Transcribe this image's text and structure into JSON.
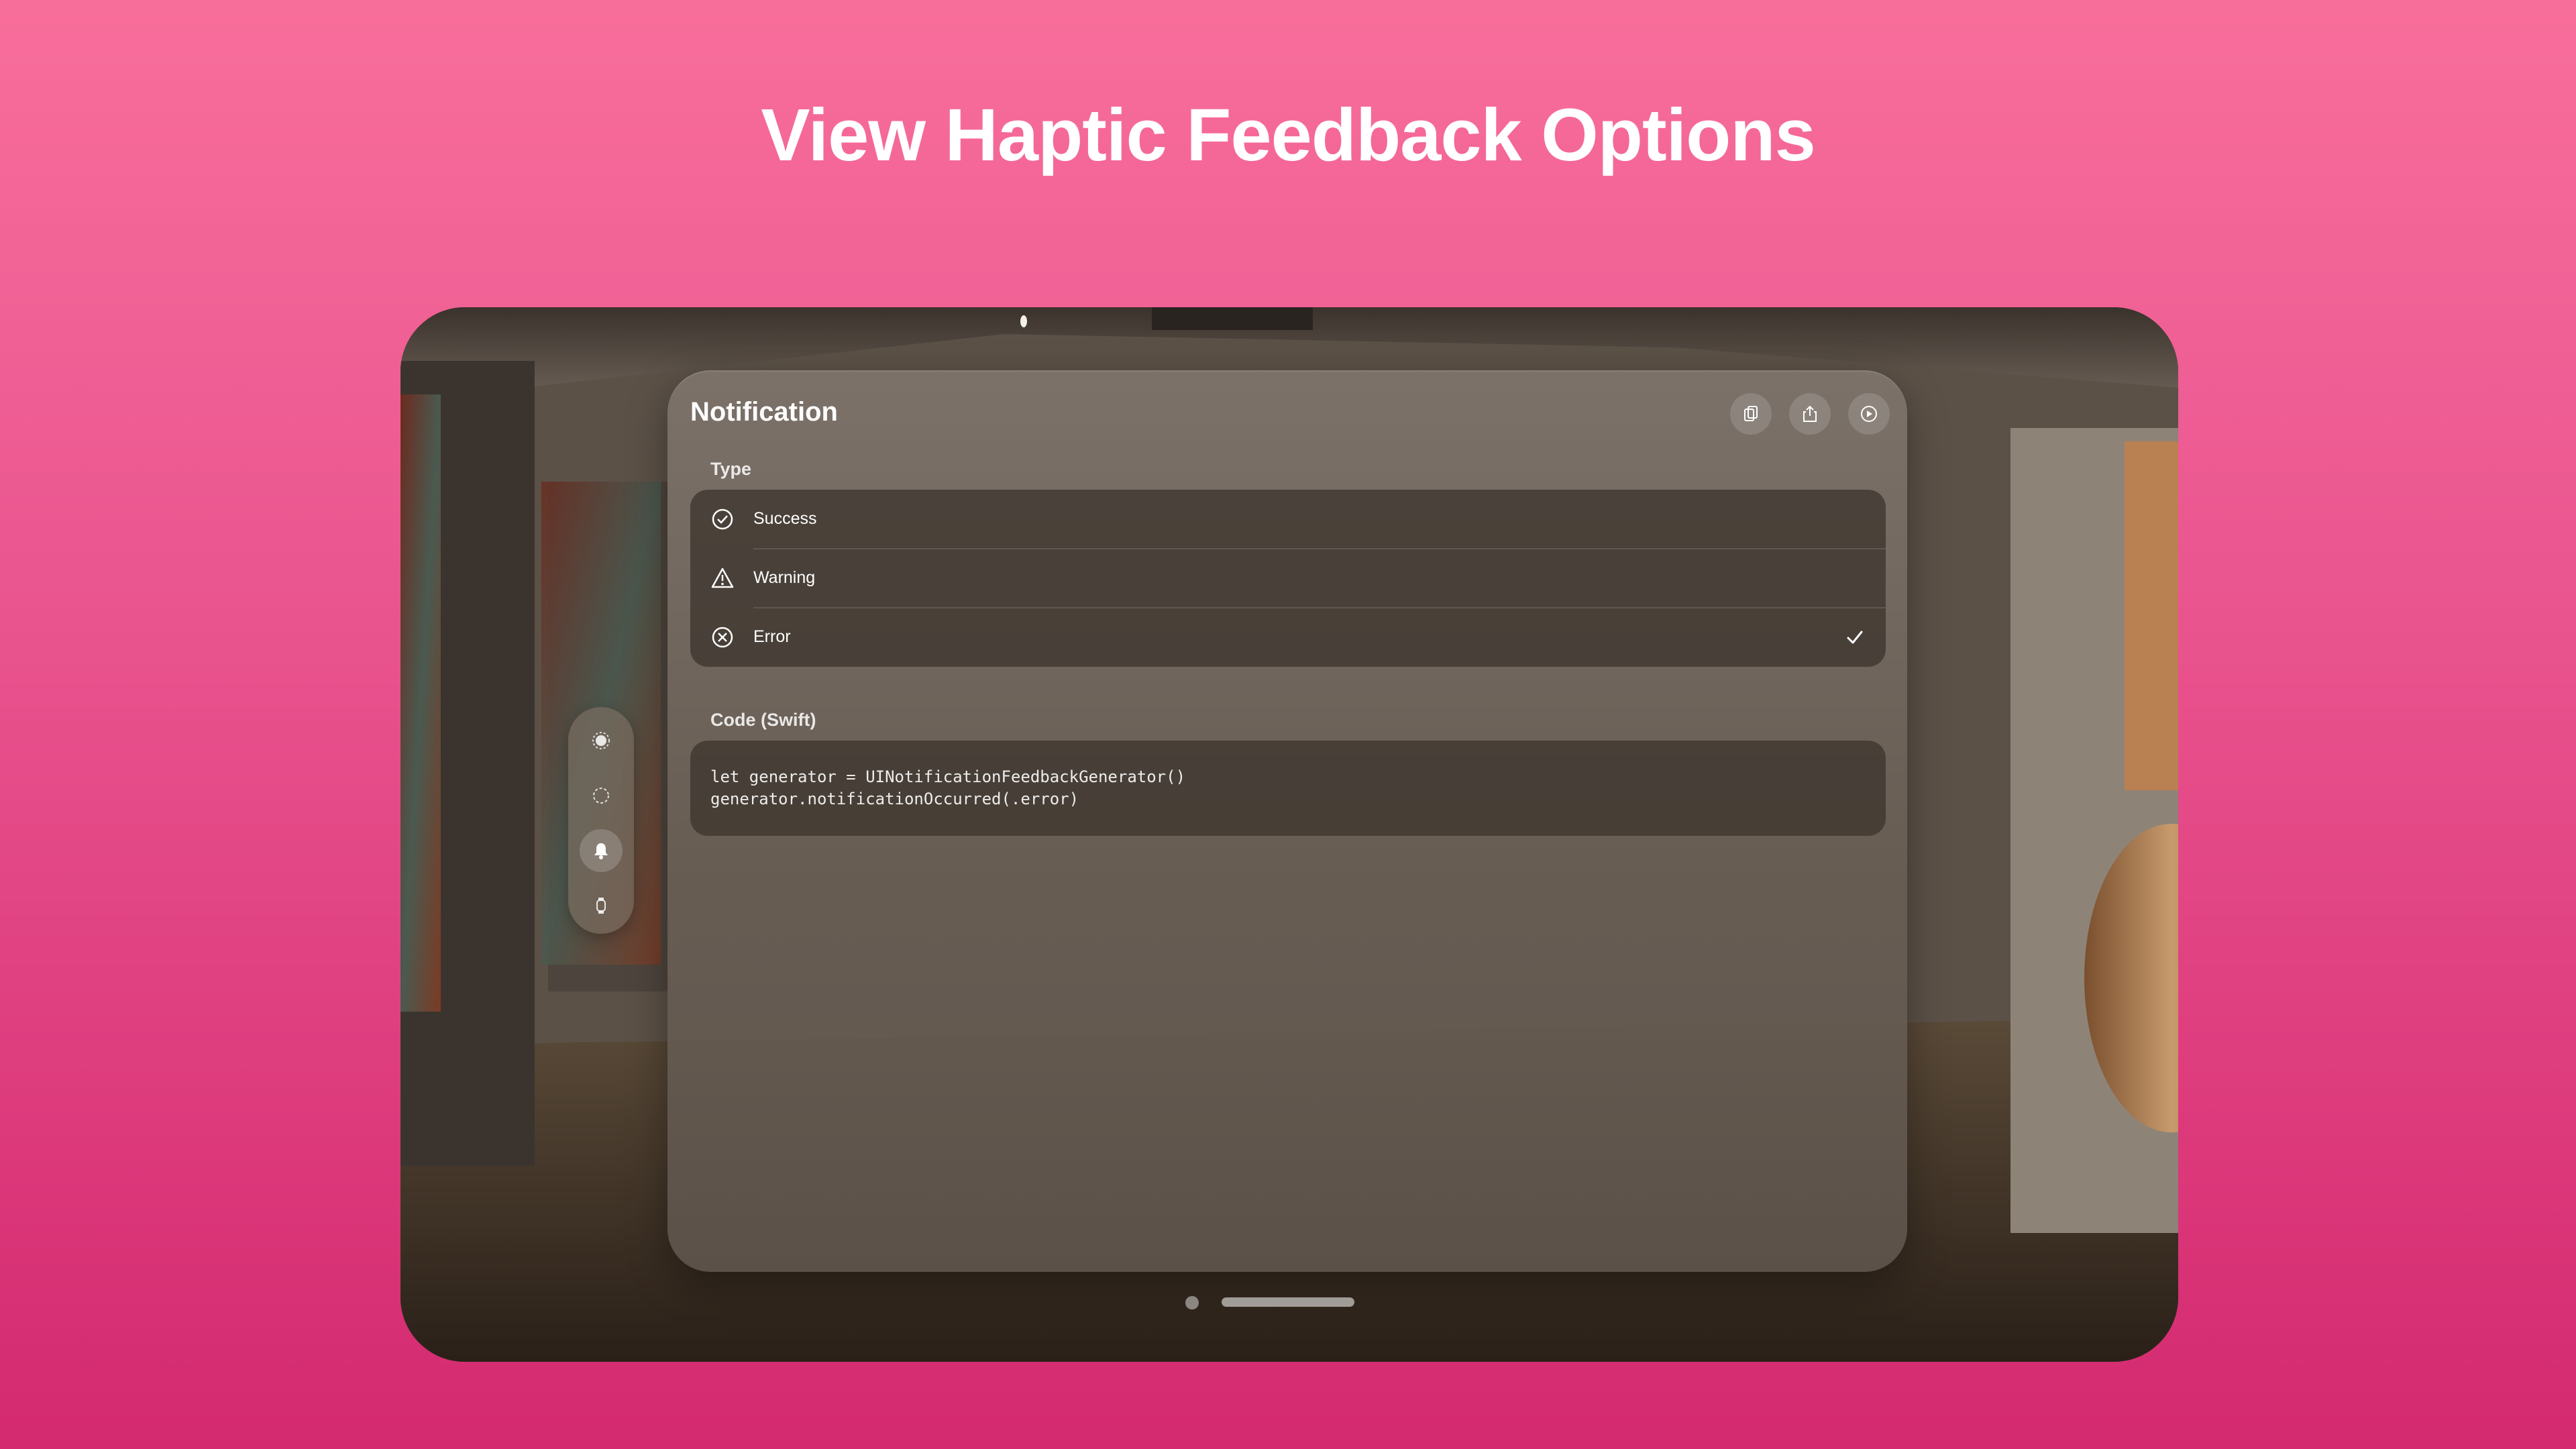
{
  "headline": "View Haptic Feedback Options",
  "panel": {
    "title": "Notification",
    "toolbar": {
      "copy_icon": "doc-on-doc-icon",
      "share_icon": "share-icon",
      "play_icon": "play-circle-icon"
    },
    "type_section_label": "Type",
    "types": [
      {
        "label": "Success",
        "icon": "checkmark-circle-icon",
        "selected": false
      },
      {
        "label": "Warning",
        "icon": "warning-triangle-icon",
        "selected": false
      },
      {
        "label": "Error",
        "icon": "xmark-circle-icon",
        "selected": true
      }
    ],
    "code_section_label": "Code (Swift)",
    "code_lines": [
      "let generator = UINotificationFeedbackGenerator()",
      "generator.notificationOccurred(.error)"
    ]
  },
  "side_rail": [
    {
      "name": "impact",
      "icon": "impact-burst-icon",
      "active": false
    },
    {
      "name": "selection",
      "icon": "dashed-circle-icon",
      "active": false
    },
    {
      "name": "notification",
      "icon": "bell-icon",
      "active": true
    },
    {
      "name": "device",
      "icon": "watch-icon",
      "active": false
    }
  ],
  "colors": {
    "background_top": "#f86e9b",
    "background_bottom": "#d4296f",
    "text": "#ffffff"
  }
}
